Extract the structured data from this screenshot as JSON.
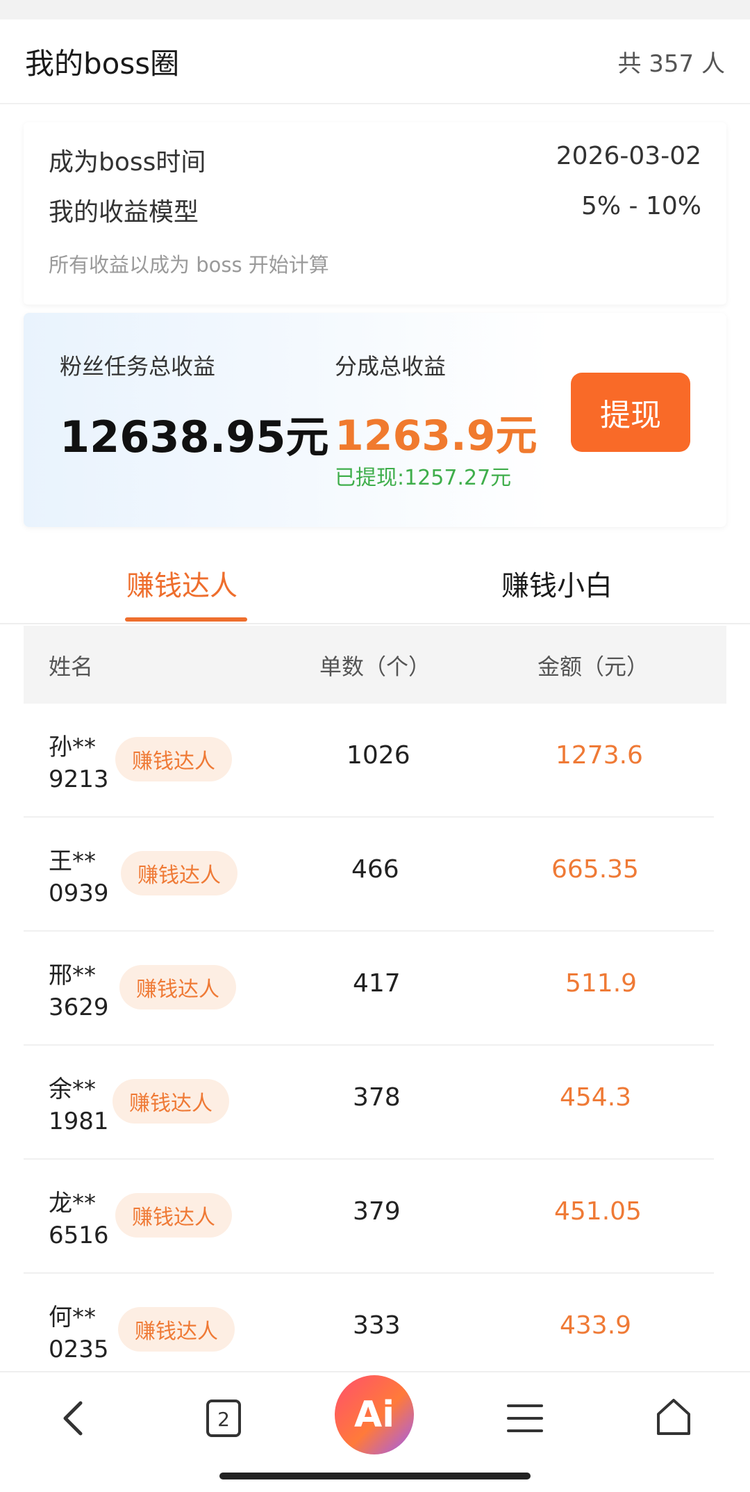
{
  "header": {
    "title": "我的boss圈",
    "count": "共 357 人"
  },
  "info": {
    "boss_time_label": "成为boss时间",
    "boss_time_value": "2026-03-02",
    "model_label": "我的收益模型",
    "model_value": "5% - 10%",
    "note": "所有收益以成为 boss 开始计算"
  },
  "earnings": {
    "fans_label": "粉丝任务总收益",
    "fans_value": "12638.95元",
    "share_label": "分成总收益",
    "share_value": "1263.9元",
    "withdrawn": "已提现:1257.27元",
    "withdraw_button": "提现"
  },
  "tabs": [
    {
      "label": "赚钱达人",
      "active": true
    },
    {
      "label": "赚钱小白",
      "active": false
    }
  ],
  "table": {
    "headers": {
      "name": "姓名",
      "count": "单数（个）",
      "amount": "金额（元）"
    },
    "rows": [
      {
        "name": "孙**",
        "id": "9213",
        "badge": "赚钱达人",
        "count": "1026",
        "amount": "1273.6"
      },
      {
        "name": "王**",
        "id": "0939",
        "badge": "赚钱达人",
        "count": "466",
        "amount": "665.35"
      },
      {
        "name": "邢**",
        "id": "3629",
        "badge": "赚钱达人",
        "count": "417",
        "amount": "511.9"
      },
      {
        "name": "余**",
        "id": "1981",
        "badge": "赚钱达人",
        "count": "378",
        "amount": "454.3"
      },
      {
        "name": "龙**",
        "id": "6516",
        "badge": "赚钱达人",
        "count": "379",
        "amount": "451.05"
      },
      {
        "name": "何**",
        "id": "0235",
        "badge": "赚钱达人",
        "count": "333",
        "amount": "433.9"
      }
    ]
  },
  "nav": {
    "tab_count": "2",
    "ai_label": "Ai",
    "items": [
      "back-icon",
      "tabs-icon",
      "ai-assistant-icon",
      "menu-icon",
      "home-icon"
    ]
  },
  "colors": {
    "accent": "#ee6e2d",
    "withdraw": "#f96a28",
    "green": "#3fae4b"
  }
}
